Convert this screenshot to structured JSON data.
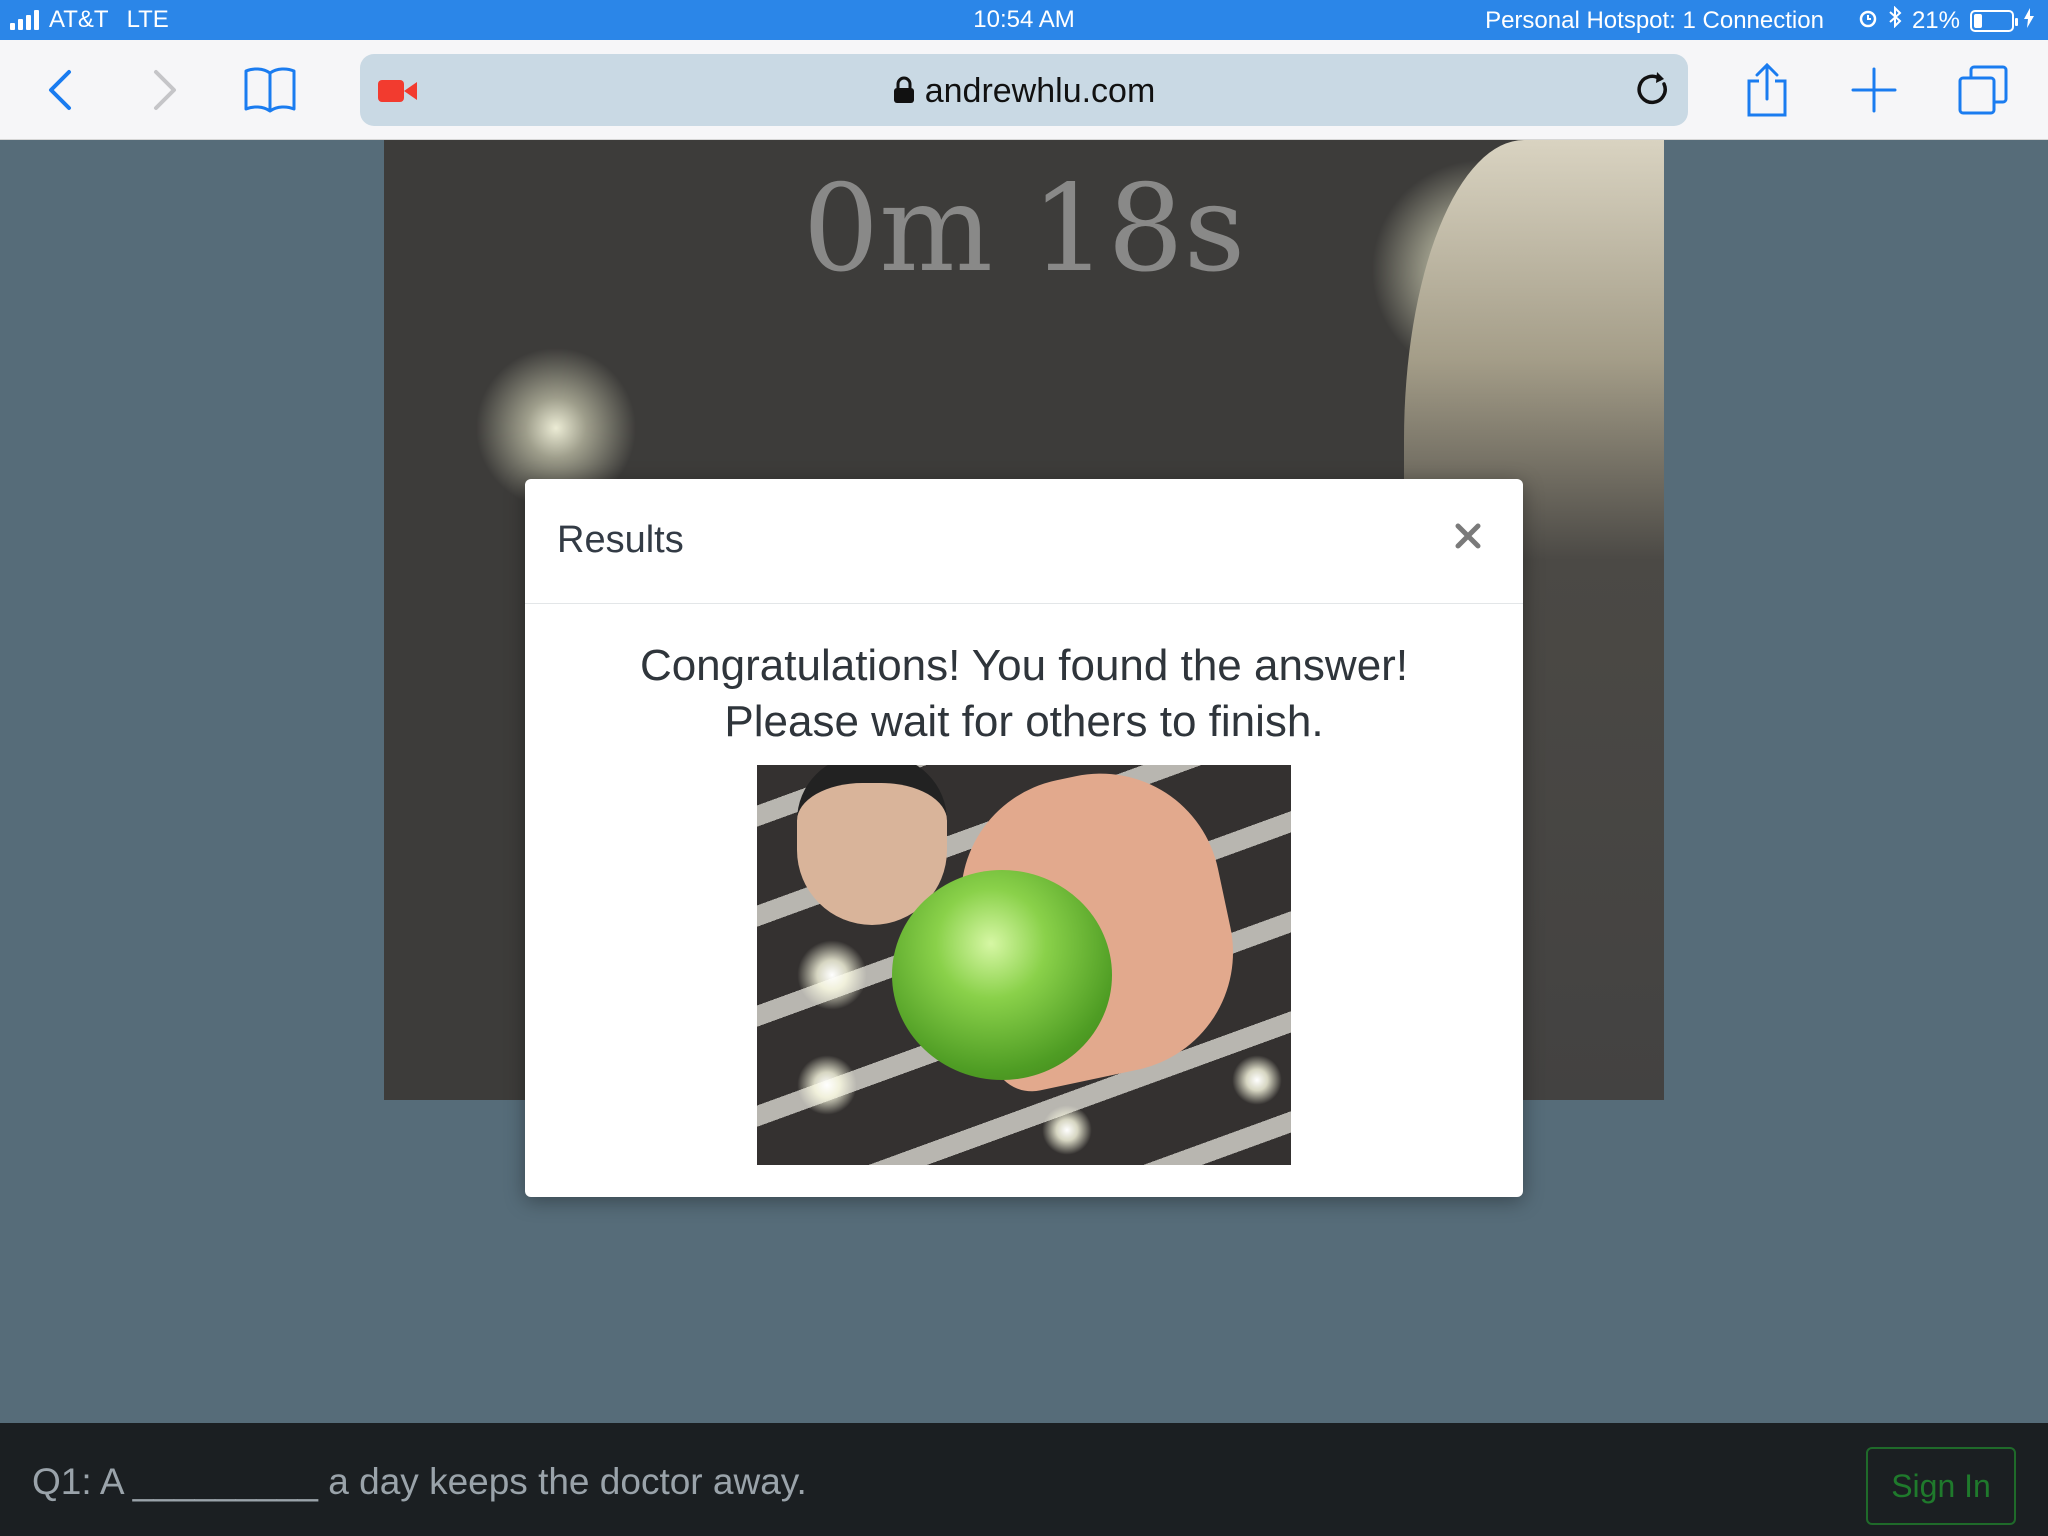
{
  "status_bar": {
    "carrier": "AT&T",
    "network": "LTE",
    "time": "10:54 AM",
    "hotspot": "Personal Hotspot: 1 Connection",
    "battery": "21%",
    "battery_level": 0.21
  },
  "browser": {
    "url": "andrewhlu.com",
    "icons": [
      "back-icon",
      "forward-icon",
      "bookmarks-icon",
      "camera-recording-icon",
      "lock-icon",
      "reload-icon",
      "share-icon",
      "new-tab-icon",
      "tabs-icon"
    ]
  },
  "page": {
    "timer": "0m 18s"
  },
  "modal": {
    "title": "Results",
    "close_label": "×",
    "message_line1": "Congratulations! You found the answer!",
    "message_line2": "Please wait for others to finish."
  },
  "bottom_bar": {
    "question": "Q1: A _________ a day keeps the doctor away.",
    "sign_in": "Sign In"
  },
  "colors": {
    "status_bar": "#2b86e8",
    "page_background": "#566c79",
    "bottom_bar": "#1b1f22",
    "sign_in_accent": "#1f7a2c"
  }
}
